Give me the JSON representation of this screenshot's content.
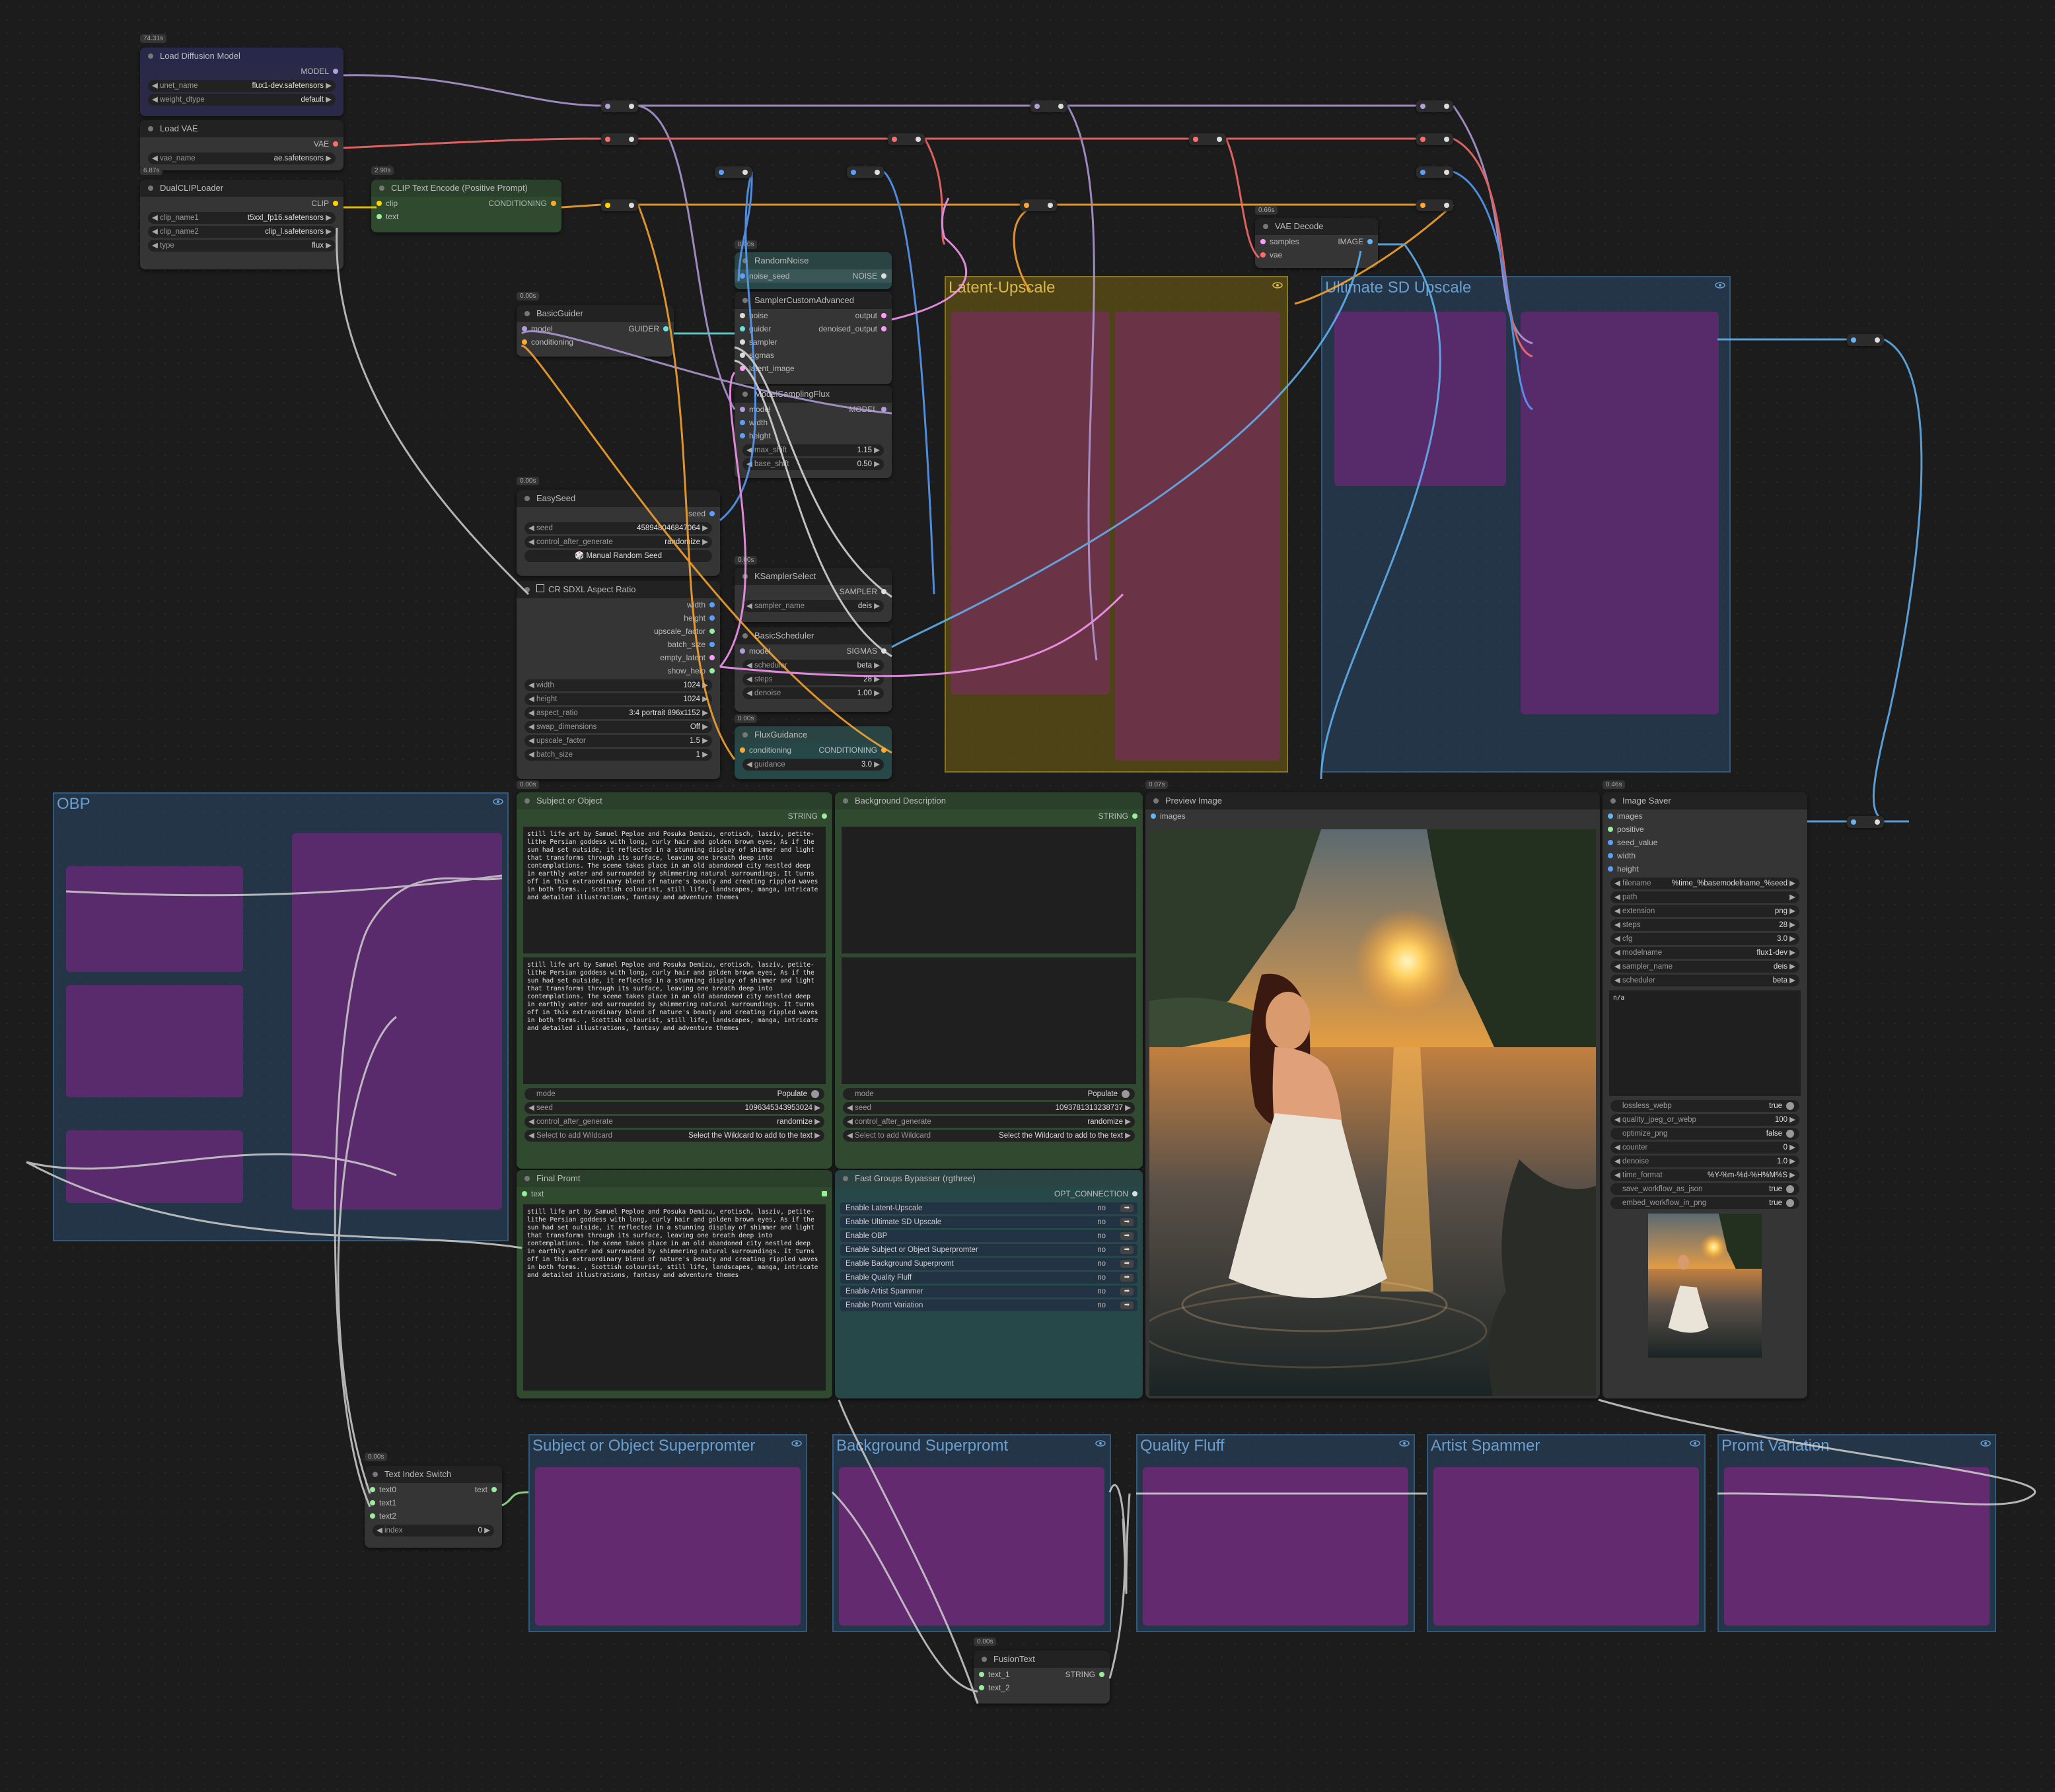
{
  "canvas": {
    "zoom_badge": "74.31s"
  },
  "groups": {
    "latent_upscale": "Latent-Upscale",
    "ultimate_sd": "Ultimate SD Upscale",
    "obp": "OBP",
    "subject_superprompter": "Subject or Object Superpromter",
    "background_superpromt": "Background Superpromt",
    "quality_fluff": "Quality Fluff",
    "artist_spammer": "Artist Spammer",
    "promt_variation": "Promt Variation"
  },
  "nodes": {
    "load_diffusion": {
      "title": "Load Diffusion Model",
      "out": "MODEL",
      "unet_k": "unet_name",
      "unet_v": "flux1-dev.safetensors",
      "dtype_k": "weight_dtype",
      "dtype_v": "default"
    },
    "load_vae": {
      "title": "Load VAE",
      "out": "VAE",
      "k": "vae_name",
      "v": "ae.safetensors",
      "badge": "6.87s"
    },
    "dual_clip": {
      "title": "DualCLIPLoader",
      "out": "CLIP",
      "c1k": "clip_name1",
      "c1v": "t5xxl_fp16.safetensors",
      "c2k": "clip_name2",
      "c2v": "clip_l.safetensors",
      "tk": "type",
      "tv": "flux"
    },
    "clip_encode": {
      "title": "CLIP Text Encode (Positive Prompt)",
      "badge": "2.90s",
      "in1": "clip",
      "in2": "text",
      "out": "CONDITIONING"
    },
    "random_noise": {
      "title": "RandomNoise",
      "badge": "0.00s",
      "in": "noise_seed",
      "out": "NOISE"
    },
    "sampler_custom": {
      "title": "SamplerCustomAdvanced",
      "ins": [
        "noise",
        "guider",
        "sampler",
        "sigmas",
        "latent_image"
      ],
      "o1": "output",
      "o2": "denoised_output"
    },
    "basic_guider": {
      "title": "BasicGuider",
      "badge": "0.00s",
      "i1": "model",
      "i2": "conditioning",
      "out": "GUIDER"
    },
    "model_sampling": {
      "title": "ModelSamplingFlux",
      "ins": [
        "model",
        "width",
        "height"
      ],
      "out": "MODEL",
      "w1k": "max_shift",
      "w1v": "1.15",
      "w2k": "base_shift",
      "w2v": "0.50"
    },
    "easy_seed": {
      "title": "EasySeed",
      "badge": "0.00s",
      "out": "seed",
      "sk": "seed",
      "sv": "458948046847064",
      "ck": "control_after_generate",
      "cv": "randomize",
      "btn": "🎲 Manual Random Seed"
    },
    "ksampler_select": {
      "title": "KSamplerSelect",
      "badge": "0.00s",
      "out": "SAMPLER",
      "k": "sampler_name",
      "v": "deis"
    },
    "basic_scheduler": {
      "title": "BasicScheduler",
      "in": "model",
      "out": "SIGMAS",
      "s1k": "scheduler",
      "s1v": "beta",
      "s2k": "steps",
      "s2v": "28",
      "s3k": "denoise",
      "s3v": "1.00"
    },
    "flux_guidance": {
      "title": "FluxGuidance",
      "badge": "0.00s",
      "in": "conditioning",
      "out": "CONDITIONING",
      "k": "guidance",
      "v": "3.0"
    },
    "cr_aspect": {
      "title": "CR SDXL Aspect Ratio",
      "outs": [
        "width",
        "height",
        "upscale_factor",
        "batch_size",
        "empty_latent",
        "show_help"
      ],
      "w": [
        [
          "width",
          "1024"
        ],
        [
          "height",
          "1024"
        ],
        [
          "aspect_ratio",
          "3:4 portrait 896x1152"
        ],
        [
          "swap_dimensions",
          "Off"
        ],
        [
          "upscale_factor",
          "1.5"
        ],
        [
          "batch_size",
          "1"
        ]
      ]
    },
    "vae_decode": {
      "title": "VAE Decode",
      "badge": "0.66s",
      "i1": "samples",
      "i2": "vae",
      "out": "IMAGE"
    },
    "subject": {
      "title": "Subject or Object",
      "badge": "0.00s",
      "out": "STRING",
      "text": "still life art by Samuel Peploe and Posuka Demizu, erotisch, lasziv, petite-lithe Persian goddess with long, curly hair and golden brown eyes, As if the sun had set outside, it reflected in a stunning display of shimmer and light that transforms through its surface, leaving one breath deep into contemplations. The scene takes place in an old abandoned city nestled deep in earthly water and surrounded by shimmering natural surroundings. It turns off in this extraordinary blend of nature's beauty and creating rippled waves in both forms. , Scottish colourist, still life, landscapes, manga, intricate and detailed illustrations, fantasy and adventure themes",
      "mode_k": "mode",
      "mode_v": "Populate",
      "seed_k": "seed",
      "seed_v": "1096345343953024",
      "ctl_k": "control_after_generate",
      "ctl_v": "randomize",
      "wc_k": "Select to add Wildcard",
      "wc_v": "Select the Wildcard to add to the text"
    },
    "background": {
      "title": "Background Description",
      "out": "STRING",
      "mode_k": "mode",
      "mode_v": "Populate",
      "seed_k": "seed",
      "seed_v": "1093781313238737",
      "ctl_k": "control_after_generate",
      "ctl_v": "randomize",
      "wc_k": "Select to add Wildcard",
      "wc_v": "Select the Wildcard to add to the text"
    },
    "final_prompt": {
      "title": "Final Promt",
      "in": "text"
    },
    "fast_groups": {
      "title": "Fast Groups Bypasser (rgthree)",
      "out": "OPT_CONNECTION",
      "rows": [
        [
          "Enable Latent-Upscale",
          "no"
        ],
        [
          "Enable Ultimate SD Upscale",
          "no"
        ],
        [
          "Enable OBP",
          "no"
        ],
        [
          "Enable Subject or Object Superpromter",
          "no"
        ],
        [
          "Enable Background Superpromt",
          "no"
        ],
        [
          "Enable Quality Fluff",
          "no"
        ],
        [
          "Enable Artist Spammer",
          "no"
        ],
        [
          "Enable Promt Variation",
          "no"
        ]
      ]
    },
    "preview": {
      "title": "Preview Image",
      "badge": "0.07s",
      "in": "images"
    },
    "image_saver": {
      "title": "Image Saver",
      "badge": "0.46s",
      "ins": [
        "images",
        "positive",
        "seed_value",
        "width",
        "height"
      ],
      "w1": [
        [
          "filename",
          "%time_%basemodelname_%seed"
        ],
        [
          "path",
          ""
        ],
        [
          "extension",
          "png"
        ],
        [
          "steps",
          "28"
        ],
        [
          "cfg",
          "3.0"
        ],
        [
          "modelname",
          "flux1-dev"
        ],
        [
          "sampler_name",
          "deis"
        ],
        [
          "scheduler",
          "beta"
        ]
      ],
      "notes": "n/a",
      "w2": [
        [
          "lossless_webp",
          "true"
        ],
        [
          "quality_jpeg_or_webp",
          "100"
        ],
        [
          "optimize_png",
          "false"
        ],
        [
          "counter",
          "0"
        ],
        [
          "denoise",
          "1.0"
        ],
        [
          "time_format",
          "%Y-%m-%d-%H%M%S"
        ],
        [
          "save_workflow_as_json",
          "true"
        ],
        [
          "embed_workflow_in_png",
          "true"
        ]
      ]
    },
    "text_switch": {
      "title": "Text Index Switch",
      "badge": "0.00s",
      "ins": [
        "text0",
        "text1",
        "text2"
      ],
      "out": "text",
      "k": "index",
      "v": "0"
    },
    "fusion_text": {
      "title": "FusionText",
      "badge": "0.00s",
      "ins": [
        "text_1",
        "text_2"
      ],
      "out": "STRING"
    }
  },
  "colors": {
    "model": "#b39ddb",
    "vae": "#ff6e6e",
    "clip": "#ffd500",
    "conditioning": "#ffa931",
    "latent": "#ff9cf9",
    "image": "#64b5f6",
    "string": "#9aed9a",
    "noise": "#b0b0b0",
    "int": "#5aa0ff"
  }
}
